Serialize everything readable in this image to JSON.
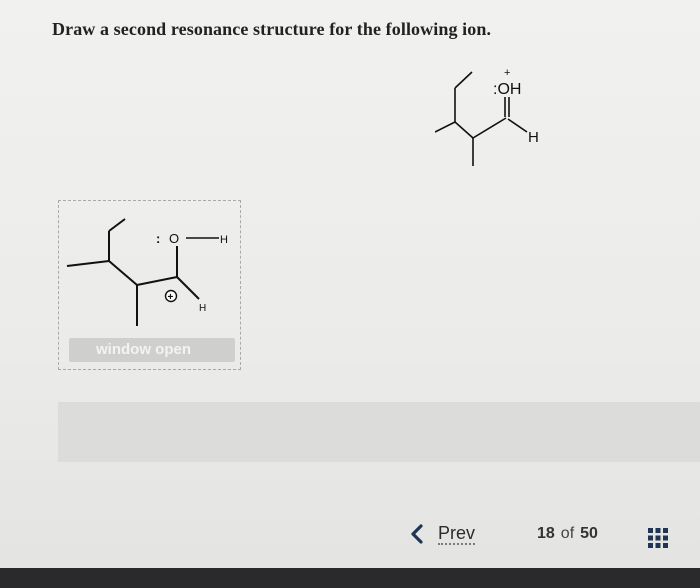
{
  "question": {
    "text": "Draw a second resonance structure for the following ion."
  },
  "molecule": {
    "oh_label": ":OH",
    "charge": "+",
    "h_label": "H"
  },
  "answer_box": {
    "o_lone_pair": ":",
    "o_label": "O",
    "o_h_label": "H",
    "charge": "+",
    "h_label": "H",
    "button_label": "window open"
  },
  "pager": {
    "prev_label": "Prev",
    "current": "18",
    "of": "of",
    "total": "50"
  },
  "colors": {
    "accent_dark": "#1f3553",
    "text": "#222222"
  },
  "icons": [
    "chevron-left-icon",
    "grid-icon"
  ]
}
